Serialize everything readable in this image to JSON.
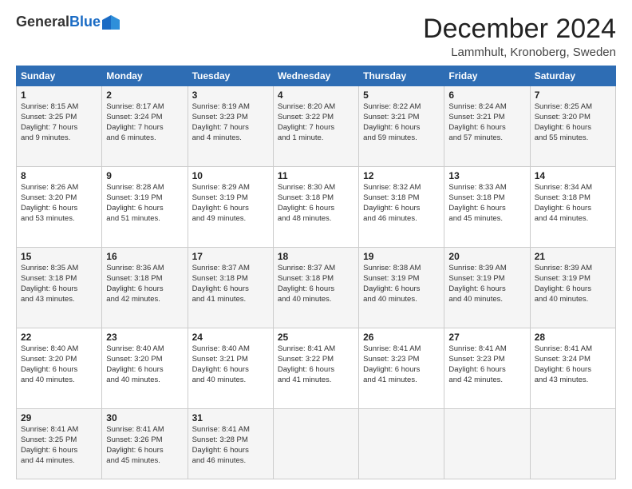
{
  "header": {
    "logo_general": "General",
    "logo_blue": "Blue",
    "month": "December 2024",
    "location": "Lammhult, Kronoberg, Sweden"
  },
  "days_of_week": [
    "Sunday",
    "Monday",
    "Tuesday",
    "Wednesday",
    "Thursday",
    "Friday",
    "Saturday"
  ],
  "weeks": [
    [
      {
        "day": "1",
        "lines": [
          "Sunrise: 8:15 AM",
          "Sunset: 3:25 PM",
          "Daylight: 7 hours",
          "and 9 minutes."
        ]
      },
      {
        "day": "2",
        "lines": [
          "Sunrise: 8:17 AM",
          "Sunset: 3:24 PM",
          "Daylight: 7 hours",
          "and 6 minutes."
        ]
      },
      {
        "day": "3",
        "lines": [
          "Sunrise: 8:19 AM",
          "Sunset: 3:23 PM",
          "Daylight: 7 hours",
          "and 4 minutes."
        ]
      },
      {
        "day": "4",
        "lines": [
          "Sunrise: 8:20 AM",
          "Sunset: 3:22 PM",
          "Daylight: 7 hours",
          "and 1 minute."
        ]
      },
      {
        "day": "5",
        "lines": [
          "Sunrise: 8:22 AM",
          "Sunset: 3:21 PM",
          "Daylight: 6 hours",
          "and 59 minutes."
        ]
      },
      {
        "day": "6",
        "lines": [
          "Sunrise: 8:24 AM",
          "Sunset: 3:21 PM",
          "Daylight: 6 hours",
          "and 57 minutes."
        ]
      },
      {
        "day": "7",
        "lines": [
          "Sunrise: 8:25 AM",
          "Sunset: 3:20 PM",
          "Daylight: 6 hours",
          "and 55 minutes."
        ]
      }
    ],
    [
      {
        "day": "8",
        "lines": [
          "Sunrise: 8:26 AM",
          "Sunset: 3:20 PM",
          "Daylight: 6 hours",
          "and 53 minutes."
        ]
      },
      {
        "day": "9",
        "lines": [
          "Sunrise: 8:28 AM",
          "Sunset: 3:19 PM",
          "Daylight: 6 hours",
          "and 51 minutes."
        ]
      },
      {
        "day": "10",
        "lines": [
          "Sunrise: 8:29 AM",
          "Sunset: 3:19 PM",
          "Daylight: 6 hours",
          "and 49 minutes."
        ]
      },
      {
        "day": "11",
        "lines": [
          "Sunrise: 8:30 AM",
          "Sunset: 3:18 PM",
          "Daylight: 6 hours",
          "and 48 minutes."
        ]
      },
      {
        "day": "12",
        "lines": [
          "Sunrise: 8:32 AM",
          "Sunset: 3:18 PM",
          "Daylight: 6 hours",
          "and 46 minutes."
        ]
      },
      {
        "day": "13",
        "lines": [
          "Sunrise: 8:33 AM",
          "Sunset: 3:18 PM",
          "Daylight: 6 hours",
          "and 45 minutes."
        ]
      },
      {
        "day": "14",
        "lines": [
          "Sunrise: 8:34 AM",
          "Sunset: 3:18 PM",
          "Daylight: 6 hours",
          "and 44 minutes."
        ]
      }
    ],
    [
      {
        "day": "15",
        "lines": [
          "Sunrise: 8:35 AM",
          "Sunset: 3:18 PM",
          "Daylight: 6 hours",
          "and 43 minutes."
        ]
      },
      {
        "day": "16",
        "lines": [
          "Sunrise: 8:36 AM",
          "Sunset: 3:18 PM",
          "Daylight: 6 hours",
          "and 42 minutes."
        ]
      },
      {
        "day": "17",
        "lines": [
          "Sunrise: 8:37 AM",
          "Sunset: 3:18 PM",
          "Daylight: 6 hours",
          "and 41 minutes."
        ]
      },
      {
        "day": "18",
        "lines": [
          "Sunrise: 8:37 AM",
          "Sunset: 3:18 PM",
          "Daylight: 6 hours",
          "and 40 minutes."
        ]
      },
      {
        "day": "19",
        "lines": [
          "Sunrise: 8:38 AM",
          "Sunset: 3:19 PM",
          "Daylight: 6 hours",
          "and 40 minutes."
        ]
      },
      {
        "day": "20",
        "lines": [
          "Sunrise: 8:39 AM",
          "Sunset: 3:19 PM",
          "Daylight: 6 hours",
          "and 40 minutes."
        ]
      },
      {
        "day": "21",
        "lines": [
          "Sunrise: 8:39 AM",
          "Sunset: 3:19 PM",
          "Daylight: 6 hours",
          "and 40 minutes."
        ]
      }
    ],
    [
      {
        "day": "22",
        "lines": [
          "Sunrise: 8:40 AM",
          "Sunset: 3:20 PM",
          "Daylight: 6 hours",
          "and 40 minutes."
        ]
      },
      {
        "day": "23",
        "lines": [
          "Sunrise: 8:40 AM",
          "Sunset: 3:20 PM",
          "Daylight: 6 hours",
          "and 40 minutes."
        ]
      },
      {
        "day": "24",
        "lines": [
          "Sunrise: 8:40 AM",
          "Sunset: 3:21 PM",
          "Daylight: 6 hours",
          "and 40 minutes."
        ]
      },
      {
        "day": "25",
        "lines": [
          "Sunrise: 8:41 AM",
          "Sunset: 3:22 PM",
          "Daylight: 6 hours",
          "and 41 minutes."
        ]
      },
      {
        "day": "26",
        "lines": [
          "Sunrise: 8:41 AM",
          "Sunset: 3:23 PM",
          "Daylight: 6 hours",
          "and 41 minutes."
        ]
      },
      {
        "day": "27",
        "lines": [
          "Sunrise: 8:41 AM",
          "Sunset: 3:23 PM",
          "Daylight: 6 hours",
          "and 42 minutes."
        ]
      },
      {
        "day": "28",
        "lines": [
          "Sunrise: 8:41 AM",
          "Sunset: 3:24 PM",
          "Daylight: 6 hours",
          "and 43 minutes."
        ]
      }
    ],
    [
      {
        "day": "29",
        "lines": [
          "Sunrise: 8:41 AM",
          "Sunset: 3:25 PM",
          "Daylight: 6 hours",
          "and 44 minutes."
        ]
      },
      {
        "day": "30",
        "lines": [
          "Sunrise: 8:41 AM",
          "Sunset: 3:26 PM",
          "Daylight: 6 hours",
          "and 45 minutes."
        ]
      },
      {
        "day": "31",
        "lines": [
          "Sunrise: 8:41 AM",
          "Sunset: 3:28 PM",
          "Daylight: 6 hours",
          "and 46 minutes."
        ]
      },
      {
        "day": "",
        "lines": []
      },
      {
        "day": "",
        "lines": []
      },
      {
        "day": "",
        "lines": []
      },
      {
        "day": "",
        "lines": []
      }
    ]
  ]
}
